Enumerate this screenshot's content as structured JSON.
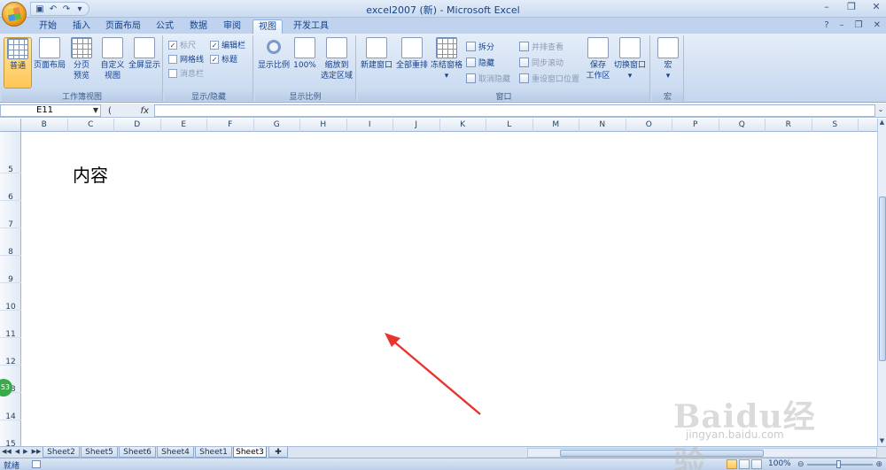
{
  "window": {
    "title": "excel2007 (新) - Microsoft Excel"
  },
  "quick_access": {
    "icons": [
      "save-icon",
      "undo-icon",
      "redo-icon",
      "customize-icon"
    ]
  },
  "ribbon_tabs": [
    "开始",
    "插入",
    "页面布局",
    "公式",
    "数据",
    "审阅",
    "视图",
    "开发工具"
  ],
  "active_tab": "视图",
  "ribbon": {
    "workbook_views": {
      "label": "工作簿视图",
      "normal": "普通",
      "page_layout": "页面布局",
      "page_break_1": "分页",
      "page_break_2": "预览",
      "custom_1": "自定义",
      "custom_2": "视图",
      "fullscreen": "全屏显示"
    },
    "show_hide": {
      "label": "显示/隐藏",
      "ruler": "标尺",
      "gridlines": "网格线",
      "message_bar": "消息栏",
      "formula_bar": "编辑栏",
      "headings": "标题"
    },
    "zoom": {
      "label": "显示比例",
      "zoom": "显示比例",
      "hundred": "100%",
      "to_sel_1": "缩放到",
      "to_sel_2": "选定区域"
    },
    "window": {
      "label": "窗口",
      "new_window": "新建窗口",
      "arrange_all": "全部重排",
      "freeze": "冻结窗格",
      "split": "拆分",
      "hide": "隐藏",
      "unhide": "取消隐藏",
      "side_by_side": "并排查看",
      "sync_scroll": "同步滚动",
      "reset_pos": "重设窗口位置",
      "save_ws_1": "保存",
      "save_ws_2": "工作区",
      "switch": "切换窗口"
    },
    "macros": {
      "label": "宏",
      "macros": "宏"
    }
  },
  "formula_bar": {
    "name_box": "E11",
    "fx": "fx",
    "value": ""
  },
  "columns": [
    "B",
    "C",
    "D",
    "E",
    "F",
    "G",
    "H",
    "I",
    "J",
    "K",
    "L",
    "M",
    "N",
    "O",
    "P",
    "Q",
    "R",
    "S"
  ],
  "rows": [
    "5",
    "6",
    "7",
    "8",
    "9",
    "10",
    "11",
    "12",
    "13",
    "14",
    "15"
  ],
  "cell_content": "内容",
  "sheet_tabs": [
    "Sheet2",
    "Sheet5",
    "Sheet6",
    "Sheet4",
    "Sheet1",
    "Sheet3"
  ],
  "active_sheet": "Sheet3",
  "status": {
    "ready": "就绪",
    "zoom": "100%"
  },
  "overlay": {
    "badge": "53",
    "watermark_main": "Baidu经验",
    "watermark_sub": "jingyan.baidu.com"
  }
}
